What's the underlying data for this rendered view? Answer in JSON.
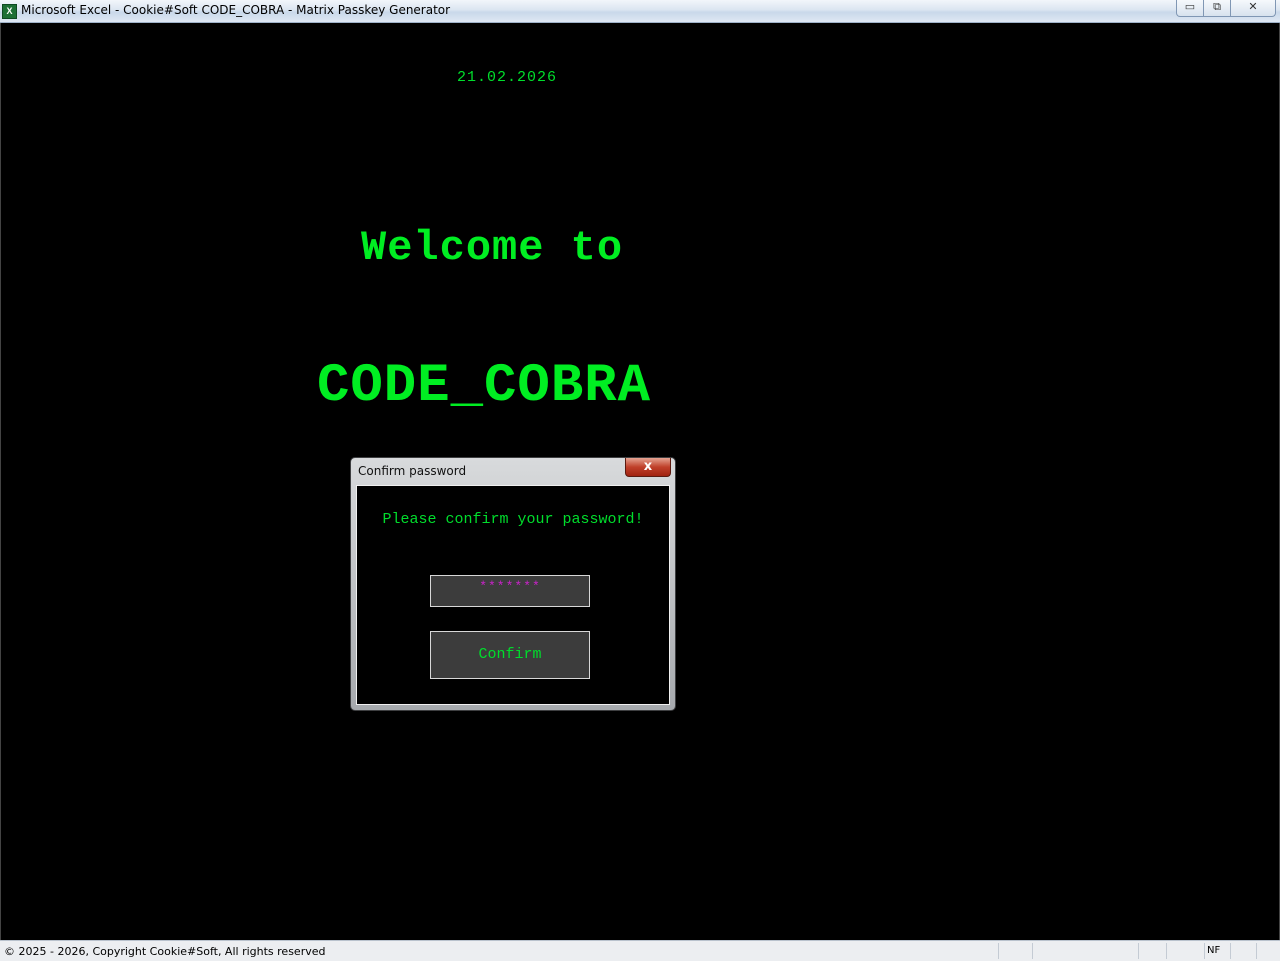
{
  "window": {
    "title": "Microsoft Excel - Cookie#Soft CODE_COBRA - Matrix Passkey Generator",
    "app_icon_label": "X",
    "controls": {
      "minimize": "▭",
      "restore": "⧉",
      "close": "✕"
    }
  },
  "splash": {
    "date": "21.02.2026",
    "welcome": "Welcome to",
    "brand": "CODE_COBRA"
  },
  "dialog": {
    "title": "Confirm password",
    "close_label": "x",
    "prompt": "Please confirm your password!",
    "password_mask": "*******",
    "confirm_label": "Confirm"
  },
  "statusbar": {
    "text": "© 2025 - 2026, Copyright Cookie#Soft, All rights reserved",
    "indicator": "NF"
  },
  "colors": {
    "matrix_green": "#00ee22",
    "mask_magenta": "#cc22cc",
    "background": "#000000"
  }
}
